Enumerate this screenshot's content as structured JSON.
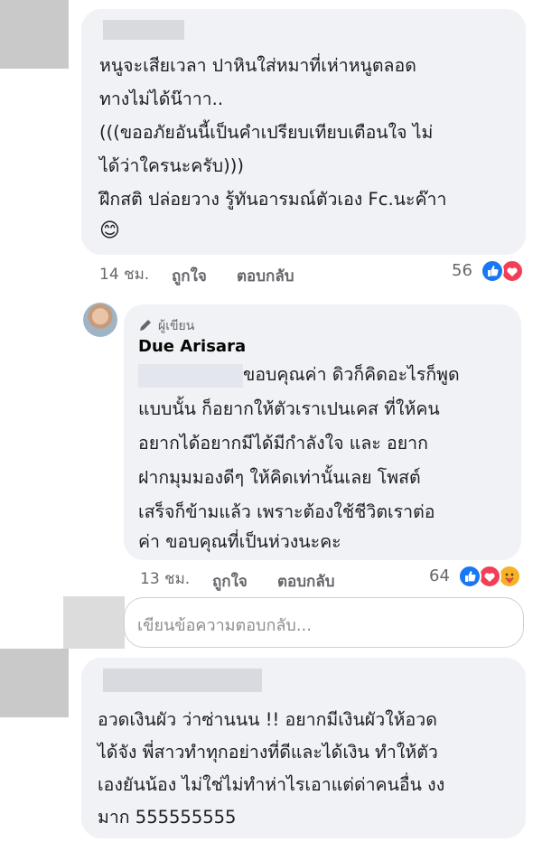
{
  "comments": [
    {
      "lines": [
        "หนูจะเสียเวลา ปาหินใส่หมาที่เห่าหนูตลอด",
        "ทางไม่ได้น๊าาา..",
        "(((ขออภัยอันนี้เป็นคำเปรียบเทียบเตือนใจ ไม่",
        "ได้ว่าใครนะครับ)))",
        "ฝึกสติ ปล่อยวาง รู้ทันอารมณ์ตัวเอง Fc.นะค๊าา",
        "😊"
      ],
      "time": "14 ชม.",
      "like": "ถูกใจ",
      "reply": "ตอบกลับ",
      "reaction_count": "56",
      "reactions": [
        "like",
        "love"
      ]
    },
    {
      "author_badge": "ผู้เขียน",
      "author_name": "Due Arisara",
      "lines": [
        "ขอบคุณค่า ดิวก็คิดอะไรก็พูด",
        "แบบนั้น ก็อยากให้ตัวเราเปนเคส ที่ให้คน",
        "อยากได้อยากมีได้มีกำลังใจ และ อยาก",
        "ฝากมุมมองดีๆ ให้คิดเท่านั้นเลย โพสต์",
        "เสร็จก็ข้ามแล้ว เพราะต้องใช้ชีวิตเราต่อ",
        "ค่า ขอบคุณที่เป็นห่วงนะคะ"
      ],
      "time": "13 ชม.",
      "like": "ถูกใจ",
      "reply": "ตอบกลับ",
      "reaction_count": "64",
      "reactions": [
        "like",
        "love",
        "care"
      ]
    },
    {
      "lines": [
        "อวดเงินผัว ว่าซ่านนน !! อยากมีเงินผัวให้อวด",
        "ได้จัง พี่สาวทำทุกอย่างที่ดีและได้เงิน ทำให้ตัว",
        "เองยันน้อง ไม่ใช่ไม่ทำห่าไรเอาแต่ด่าคนอื่น งง",
        "มาก 555555555"
      ]
    }
  ],
  "reply_input": {
    "placeholder": "เขียนข้อความตอบกลับ..."
  },
  "icons": {
    "pencil": "pencil-icon",
    "like": "like-icon",
    "love": "love-icon",
    "care": "care-icon"
  },
  "colors": {
    "bubble": "#f0f2f5",
    "like": "#1877f2",
    "love": "#f33e58",
    "care": "#f7b125"
  }
}
